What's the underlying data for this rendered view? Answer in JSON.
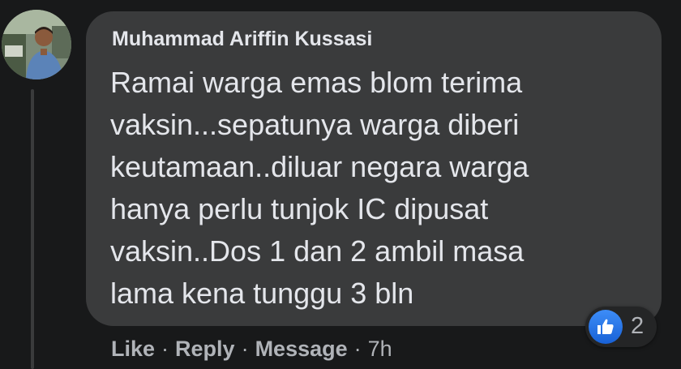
{
  "comment": {
    "author": "Muhammad Ariffin Kussasi",
    "text": "Ramai warga emas blom terima\nvaksin...sepatunya warga diberi\nkeutamaan..diluar negara warga\nhanya perlu tunjok IC dipusat\nvaksin..Dos 1 dan 2 ambil masa\nlama kena tunggu 3 bln",
    "reaction_icon": "like-icon",
    "reaction_count": "2"
  },
  "actions": {
    "like": "Like",
    "reply": "Reply",
    "message": "Message",
    "separator": "·",
    "time": "7h"
  },
  "colors": {
    "background": "#18191a",
    "bubble": "#3a3b3c",
    "text": "#e4e6eb",
    "secondary_text": "#b0b3b8",
    "like_blue": "#1877f2"
  }
}
